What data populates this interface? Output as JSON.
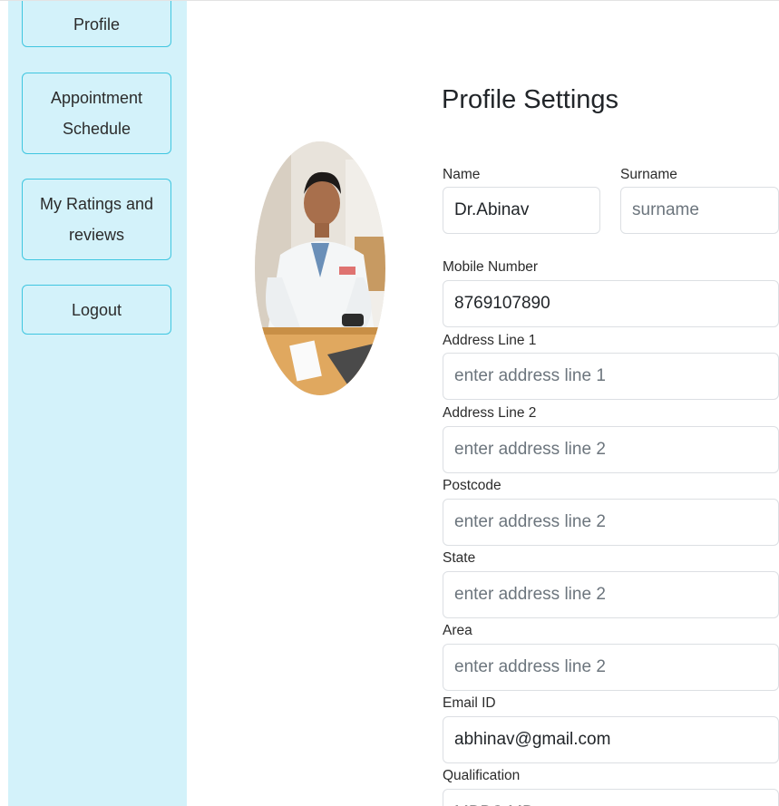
{
  "sidebar": {
    "items": [
      {
        "label": "Profile"
      },
      {
        "label": "Appointment Schedule"
      },
      {
        "label": "My Ratings and reviews"
      },
      {
        "label": "Logout"
      }
    ]
  },
  "profile": {
    "title": "Profile Settings",
    "fields": {
      "name": {
        "label": "Name",
        "value": "Dr.Abinav",
        "placeholder": ""
      },
      "surname": {
        "label": "Surname",
        "value": "",
        "placeholder": "surname"
      },
      "mobile": {
        "label": "Mobile Number",
        "value": "8769107890",
        "placeholder": ""
      },
      "address1": {
        "label": "Address Line 1",
        "value": "",
        "placeholder": "enter address line 1"
      },
      "address2": {
        "label": "Address Line 2",
        "value": "",
        "placeholder": "enter address line 2"
      },
      "postcode": {
        "label": "Postcode",
        "value": "",
        "placeholder": "enter address line 2"
      },
      "state": {
        "label": "State",
        "value": "",
        "placeholder": "enter address line 2"
      },
      "area": {
        "label": "Area",
        "value": "",
        "placeholder": "enter address line 2"
      },
      "email": {
        "label": "Email ID",
        "value": "abhinav@gmail.com",
        "placeholder": ""
      },
      "qualification": {
        "label": "Qualification",
        "value": "MBBS MD",
        "placeholder": ""
      }
    }
  },
  "colors": {
    "sidebar_bg": "#d3f2fa",
    "sidebar_border": "#3fc6e0",
    "input_border": "#dcdfe3"
  }
}
